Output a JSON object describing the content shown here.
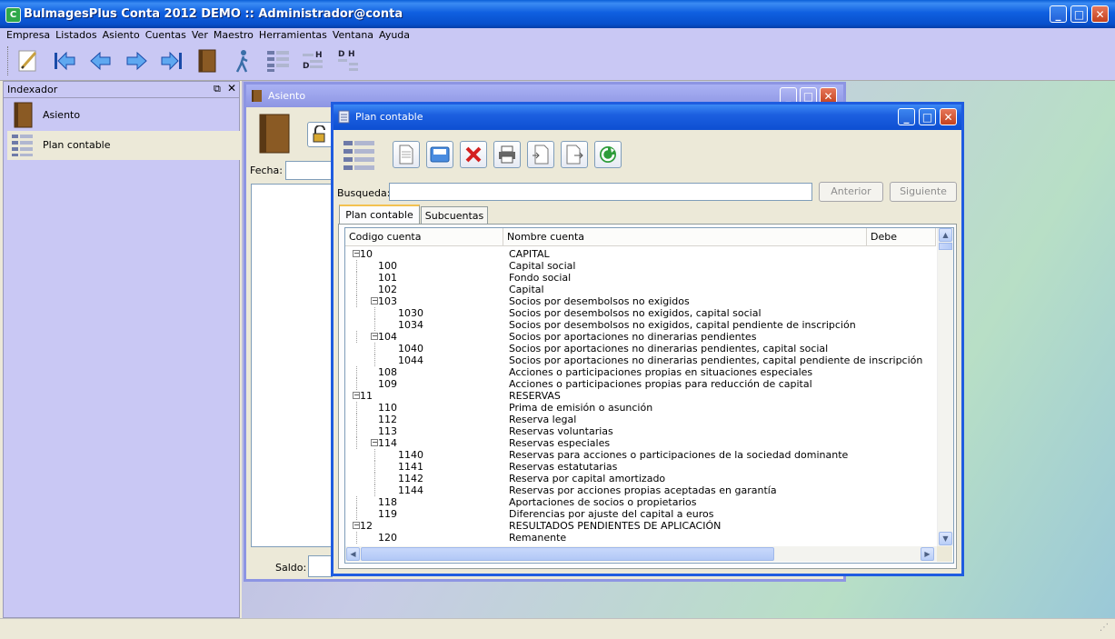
{
  "window": {
    "title": "BulmagesPlus Conta 2012 DEMO :: Administrador@conta"
  },
  "menu": [
    "Empresa",
    "Listados",
    "Asiento",
    "Cuentas",
    "Ver",
    "Maestro",
    "Herramientas",
    "Ventana",
    "Ayuda"
  ],
  "toolbar_icons": [
    "pencil-icon",
    "first-icon",
    "previous-icon",
    "next-icon",
    "last-icon",
    "book-icon",
    "walking-person-icon",
    "account-tree-icon",
    "debe-haber-icon",
    "debe-haber-list-icon"
  ],
  "dock": {
    "title": "Indexador",
    "items": [
      {
        "label": "Asiento",
        "icon": "book-icon"
      },
      {
        "label": "Plan contable",
        "icon": "tree-list-icon"
      }
    ]
  },
  "asiento": {
    "title": "Asiento",
    "fecha_label": "Fecha:",
    "saldo_label": "Saldo:"
  },
  "plan": {
    "title": "Plan contable",
    "toolbar_icons": [
      "new-document-icon",
      "save-icon",
      "delete-icon",
      "print-icon",
      "import-icon",
      "export-icon",
      "refresh-icon"
    ],
    "search_label": "Busqueda:",
    "search_value": "",
    "anterior_label": "Anterior",
    "siguiente_label": "Siguiente",
    "tabs": [
      "Plan contable",
      "Subcuentas"
    ],
    "columns": [
      "Codigo cuenta",
      "Nombre cuenta",
      "Debe"
    ],
    "rows": [
      {
        "code": "10",
        "name": "CAPITAL",
        "level": 0,
        "expander": true
      },
      {
        "code": "100",
        "name": "Capital social",
        "level": 1,
        "expander": false
      },
      {
        "code": "101",
        "name": "Fondo social",
        "level": 1,
        "expander": false
      },
      {
        "code": "102",
        "name": "Capital",
        "level": 1,
        "expander": false
      },
      {
        "code": "103",
        "name": "Socios por desembolsos no exigidos",
        "level": 1,
        "expander": true
      },
      {
        "code": "1030",
        "name": "Socios por desembolsos no exigidos, capital social",
        "level": 2,
        "expander": false
      },
      {
        "code": "1034",
        "name": "Socios por desembolsos no exigidos, capital pendiente de inscripción",
        "level": 2,
        "expander": false
      },
      {
        "code": "104",
        "name": "Socios por aportaciones no dinerarias pendientes",
        "level": 1,
        "expander": true
      },
      {
        "code": "1040",
        "name": "Socios por aportaciones no dinerarias pendientes, capital social",
        "level": 2,
        "expander": false
      },
      {
        "code": "1044",
        "name": "Socios por aportaciones no dinerarias pendientes, capital pendiente de inscripción",
        "level": 2,
        "expander": false
      },
      {
        "code": "108",
        "name": "Acciones o participaciones propias en situaciones especiales",
        "level": 1,
        "expander": false
      },
      {
        "code": "109",
        "name": "Acciones o participaciones propias para reducción de capital",
        "level": 1,
        "expander": false
      },
      {
        "code": "11",
        "name": "RESERVAS",
        "level": 0,
        "expander": true
      },
      {
        "code": "110",
        "name": "Prima de emisión o asunción",
        "level": 1,
        "expander": false
      },
      {
        "code": "112",
        "name": "Reserva legal",
        "level": 1,
        "expander": false
      },
      {
        "code": "113",
        "name": "Reservas voluntarias",
        "level": 1,
        "expander": false
      },
      {
        "code": "114",
        "name": "Reservas especiales",
        "level": 1,
        "expander": true
      },
      {
        "code": "1140",
        "name": "Reservas para acciones o participaciones de la sociedad dominante",
        "level": 2,
        "expander": false
      },
      {
        "code": "1141",
        "name": "Reservas estatutarias",
        "level": 2,
        "expander": false
      },
      {
        "code": "1142",
        "name": "Reserva por capital amortizado",
        "level": 2,
        "expander": false
      },
      {
        "code": "1144",
        "name": "Reservas por acciones propias aceptadas en garantía",
        "level": 2,
        "expander": false
      },
      {
        "code": "118",
        "name": "Aportaciones de socios o propietarios",
        "level": 1,
        "expander": false
      },
      {
        "code": "119",
        "name": "Diferencias por ajuste del capital a euros",
        "level": 1,
        "expander": false
      },
      {
        "code": "12",
        "name": "RESULTADOS PENDIENTES DE APLICACIÓN",
        "level": 0,
        "expander": true
      },
      {
        "code": "120",
        "name": "Remanente",
        "level": 1,
        "expander": false
      }
    ]
  },
  "colors": {
    "titlebar": "#0a5fd8",
    "menubar": "#c9c8f4",
    "dock_selected": "#ece9d8"
  }
}
